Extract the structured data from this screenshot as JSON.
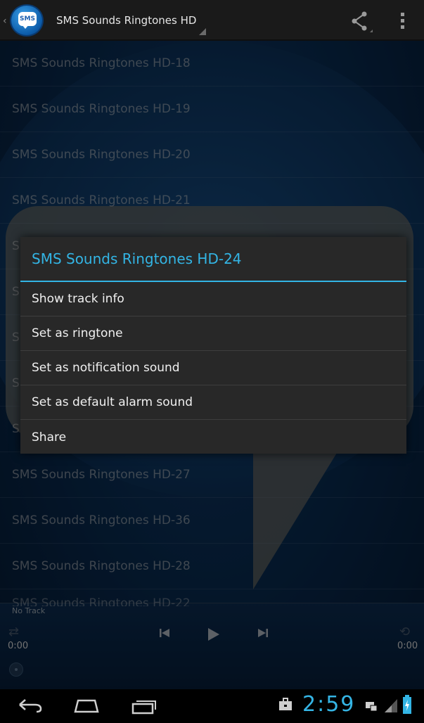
{
  "action_bar": {
    "app_icon_text": "SMS",
    "title": "SMS Sounds Ringtones HD",
    "share_icon": "share-icon",
    "overflow_icon": "overflow-menu-icon"
  },
  "list": {
    "rows": [
      "SMS Sounds Ringtones HD-18",
      "SMS Sounds Ringtones HD-19",
      "SMS Sounds Ringtones HD-20",
      "SMS Sounds Ringtones HD-21",
      "S",
      "S",
      "S",
      "S",
      "S",
      "SMS Sounds Ringtones HD-27",
      "SMS Sounds Ringtones HD-36",
      "SMS Sounds Ringtones HD-28"
    ],
    "partial_row": "SMS Sounds Ringtones HD-22"
  },
  "player": {
    "track_label": "No Track",
    "elapsed": "0:00",
    "duration": "0:00"
  },
  "dialog": {
    "title": "SMS Sounds Ringtones HD-24",
    "items": [
      "Show track info",
      "Set as ringtone",
      "Set as notification sound",
      "Set as default alarm sound",
      "Share"
    ]
  },
  "navbar": {
    "clock": "2:59"
  },
  "colors": {
    "accent": "#33b5e5",
    "dialog_bg": "#282828"
  }
}
